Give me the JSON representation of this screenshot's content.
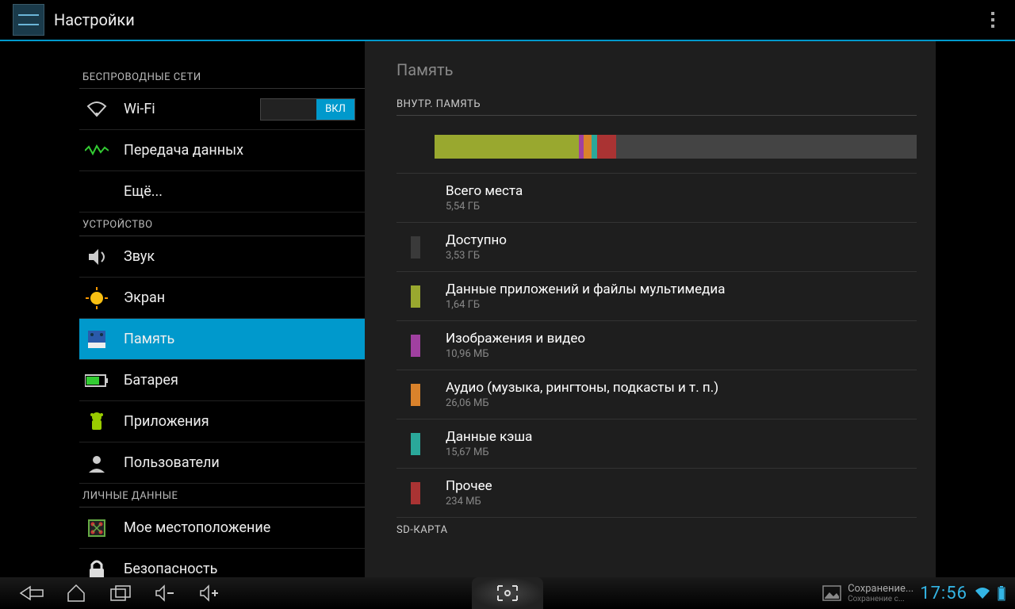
{
  "title": "Настройки",
  "sidebar": {
    "sections": [
      {
        "header": "БЕСПРОВОДНЫЕ СЕТИ",
        "items": [
          {
            "label": "Wi-Fi",
            "icon": "wifi",
            "toggle": "ВКЛ"
          },
          {
            "label": "Передача данных",
            "icon": "data"
          },
          {
            "label": "Ещё...",
            "icon": ""
          }
        ]
      },
      {
        "header": "УСТРОЙСТВО",
        "items": [
          {
            "label": "Звук",
            "icon": "sound"
          },
          {
            "label": "Экран",
            "icon": "display"
          },
          {
            "label": "Память",
            "icon": "storage",
            "selected": true
          },
          {
            "label": "Батарея",
            "icon": "battery"
          },
          {
            "label": "Приложения",
            "icon": "apps"
          },
          {
            "label": "Пользователи",
            "icon": "users"
          }
        ]
      },
      {
        "header": "ЛИЧНЫЕ ДАННЫЕ",
        "items": [
          {
            "label": "Мое местоположение",
            "icon": "location"
          },
          {
            "label": "Безопасность",
            "icon": "security"
          }
        ]
      }
    ]
  },
  "detail": {
    "title": "Память",
    "section": "ВНУТР. ПАМЯТЬ",
    "bar_segments": [
      {
        "color": "#99a82f",
        "pct": 30
      },
      {
        "color": "#a040a0",
        "pct": 1
      },
      {
        "color": "#d9822b",
        "pct": 1.5
      },
      {
        "color": "#2aa89a",
        "pct": 1.2
      },
      {
        "color": "#aa3333",
        "pct": 4
      }
    ],
    "rows": [
      {
        "label": "Всего места",
        "sub": "5,54 ГБ",
        "color": ""
      },
      {
        "label": "Доступно",
        "sub": "3,53 ГБ",
        "color": "#3a3a3a"
      },
      {
        "label": "Данные приложений и файлы мультимедиа",
        "sub": "1,64 ГБ",
        "color": "#99a82f"
      },
      {
        "label": "Изображения и видео",
        "sub": "10,96 МБ",
        "color": "#a040a0"
      },
      {
        "label": "Аудио (музыка, рингтоны, подкасты и т. п.)",
        "sub": "26,06 МБ",
        "color": "#d9822b"
      },
      {
        "label": "Данные кэша",
        "sub": "15,67 МБ",
        "color": "#2aa89a"
      },
      {
        "label": "Прочее",
        "sub": "234 МБ",
        "color": "#aa3333"
      }
    ],
    "section2": "SD-КАРТА"
  },
  "navbar": {
    "notif_title": "Сохранение...",
    "notif_sub": "Сохранение с...",
    "clock": "17:56"
  },
  "colors": {
    "accent": "#0099cc",
    "holo_blue": "#33b5e5"
  }
}
